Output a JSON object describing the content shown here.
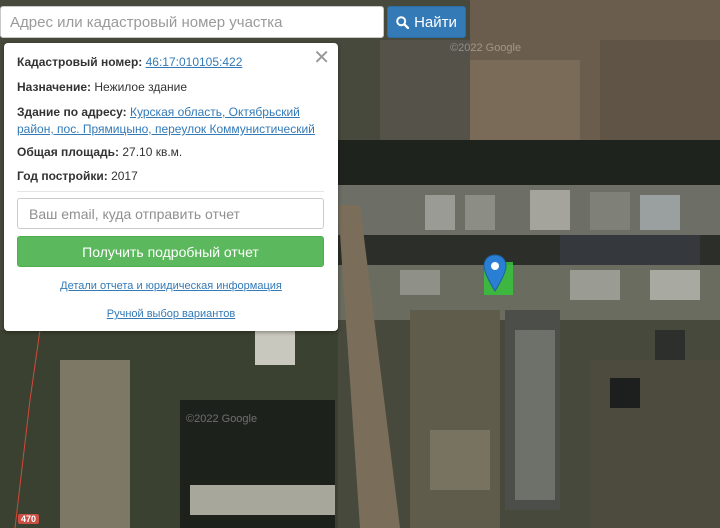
{
  "search": {
    "placeholder": "Адрес или кадастровый номер участка",
    "button_label": "Найти",
    "button_icon": "search-icon"
  },
  "info": {
    "close_icon": "close-icon",
    "cadastral_label": "Кадастровый номер:",
    "cadastral_value": "46:17:010105:422",
    "purpose_label": "Назначение:",
    "purpose_value": "Нежилое здание",
    "address_label": "Здание по адресу:",
    "address_value": "Курская область, Октябрьский район, пос. Прямицыно, переулок Коммунистический",
    "area_label": "Общая площадь:",
    "area_value": "27.10 кв.м.",
    "year_label": "Год постройки:",
    "year_value": "2017",
    "email_placeholder": "Ваш email, куда отправить отчет",
    "get_report_label": "Получить подробный отчет",
    "details_link": "Детали отчета и юридическая информация",
    "manual_link": "Ручной выбор вариантов"
  },
  "map": {
    "marker_icon": "map-pin-icon",
    "marker_color": "#2a7fd4",
    "parcel_color": "#35c43a",
    "watermark_top": "©2022 Google",
    "watermark_bottom": "©2022 Google",
    "road_number": "470",
    "accent_color": "#337ab7",
    "report_button_color": "#5cb85c"
  }
}
